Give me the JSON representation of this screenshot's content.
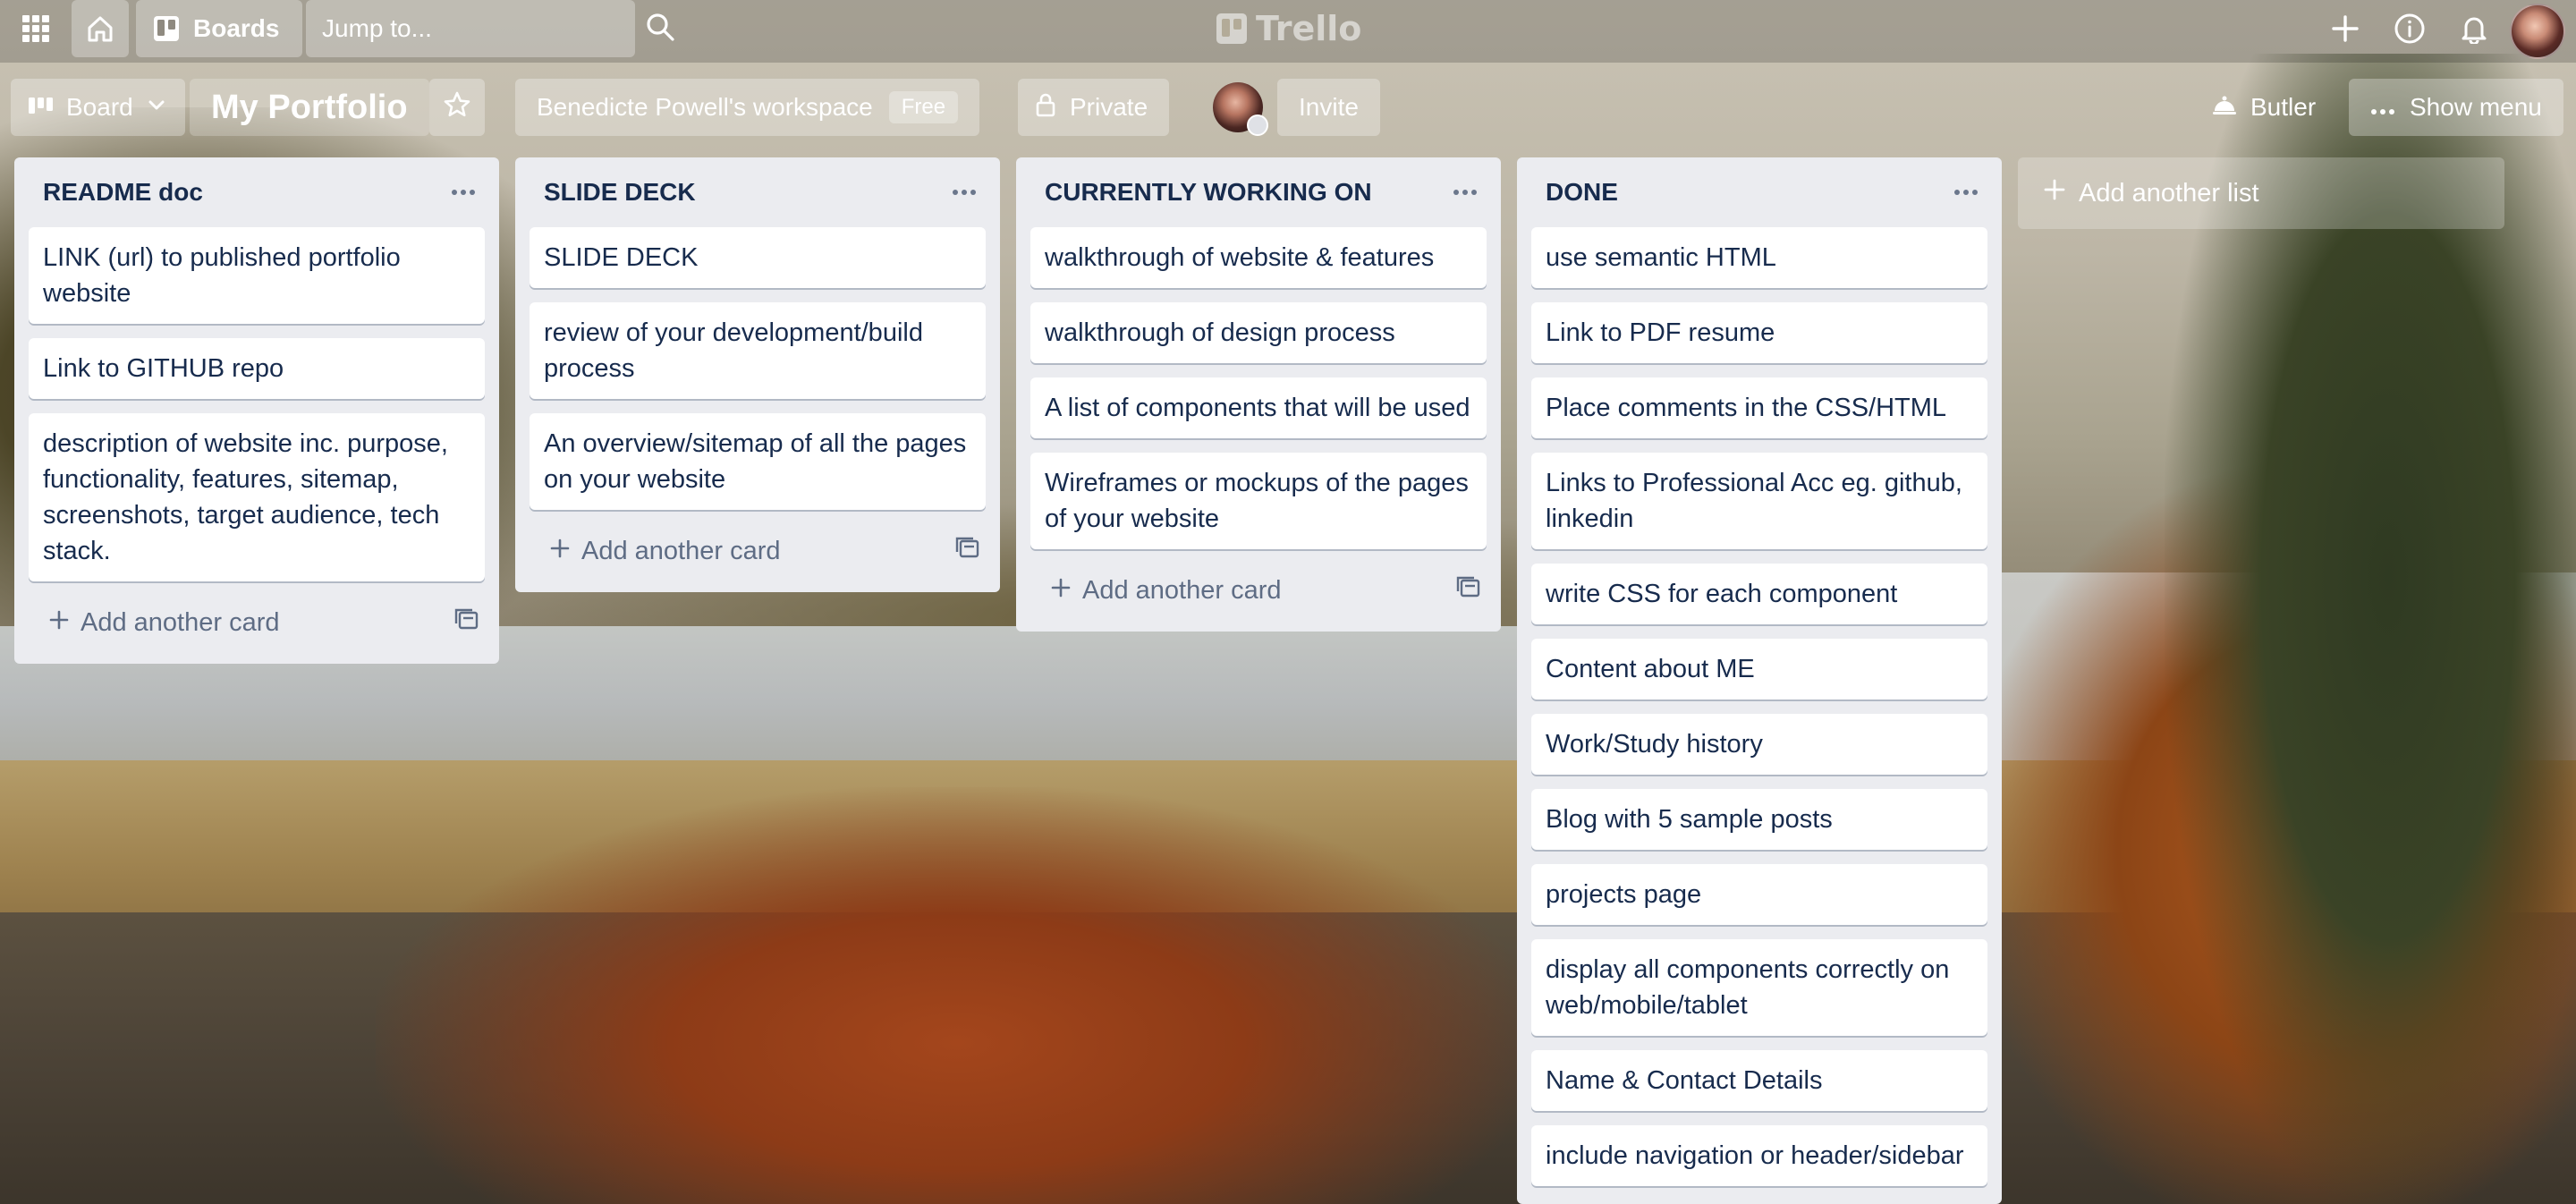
{
  "topbar": {
    "boards_label": "Boards",
    "search_placeholder": "Jump to...",
    "logo_text": "Trello"
  },
  "board_header": {
    "view_label": "Board",
    "title": "My Portfolio",
    "workspace_label": "Benedicte Powell's workspace",
    "workspace_badge": "Free",
    "visibility_label": "Private",
    "invite_label": "Invite",
    "butler_label": "Butler",
    "show_menu_label": "Show menu"
  },
  "lists": [
    {
      "title": "README doc",
      "cards": [
        "LINK (url) to published portfolio website",
        "Link to GITHUB repo",
        "description of website inc. purpose, functionality, features, sitemap, screenshots, target audience, tech stack."
      ],
      "add_card_label": "Add another card"
    },
    {
      "title": "SLIDE DECK",
      "cards": [
        "SLIDE DECK",
        "review of your development/build process",
        "An overview/sitemap of all the pages on your website"
      ],
      "add_card_label": "Add another card"
    },
    {
      "title": "CURRENTLY WORKING ON",
      "cards": [
        "walkthrough of website & features",
        "walkthrough of design process",
        "A list of components that will be used",
        "Wireframes or mockups of the pages of your website"
      ],
      "add_card_label": "Add another card"
    },
    {
      "title": "DONE",
      "cards": [
        "use semantic HTML",
        "Link to PDF resume",
        "Place comments in the CSS/HTML",
        "Links to Professional Acc eg. github, linkedin",
        "write CSS for each component",
        "Content about ME",
        "Work/Study history",
        "Blog with 5 sample posts",
        "projects page",
        "display all components correctly on web/mobile/tablet",
        "Name & Contact Details",
        "include navigation or header/sidebar"
      ]
    }
  ],
  "add_list_label": "Add another list",
  "icons": {
    "apps": "apps-grid-icon",
    "home": "home-icon",
    "boards": "boards-icon",
    "search": "search-icon",
    "create": "plus-icon",
    "info": "info-icon",
    "notifications": "bell-icon",
    "list_menu": "more-horizontal-icon",
    "card_template": "card-template-icon",
    "private": "lock-icon",
    "star": "star-icon",
    "butler": "butler-icon"
  }
}
